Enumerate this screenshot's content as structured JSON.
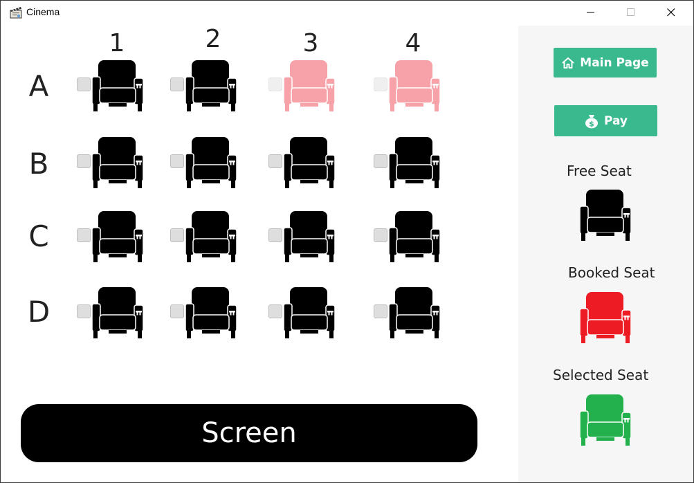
{
  "window": {
    "title": "Cinema"
  },
  "columns": [
    "1",
    "2",
    "3",
    "4"
  ],
  "rows": [
    {
      "label": "A",
      "seats": [
        "free",
        "free",
        "booked",
        "booked"
      ]
    },
    {
      "label": "B",
      "seats": [
        "free",
        "free",
        "free",
        "free"
      ]
    },
    {
      "label": "C",
      "seats": [
        "free",
        "free",
        "free",
        "free"
      ]
    },
    {
      "label": "D",
      "seats": [
        "free",
        "free",
        "free",
        "free"
      ]
    }
  ],
  "screen": {
    "label": "Screen"
  },
  "sidebar": {
    "main_page_label": "Main Page",
    "pay_label": "Pay",
    "legend": [
      {
        "label": "Free Seat",
        "status": "free"
      },
      {
        "label": "Booked Seat",
        "status": "booked-legend"
      },
      {
        "label": "Selected Seat",
        "status": "selected"
      }
    ]
  },
  "colors": {
    "free": "#000000",
    "booked": "#f7a1a8",
    "booked-legend": "#ed1c24",
    "selected": "#22b14c",
    "button": "#3ab88e"
  },
  "icons": {
    "app": "clapperboard-icon",
    "main_page": "home-icon",
    "pay": "money-bag-icon",
    "seat": "armchair-icon"
  }
}
